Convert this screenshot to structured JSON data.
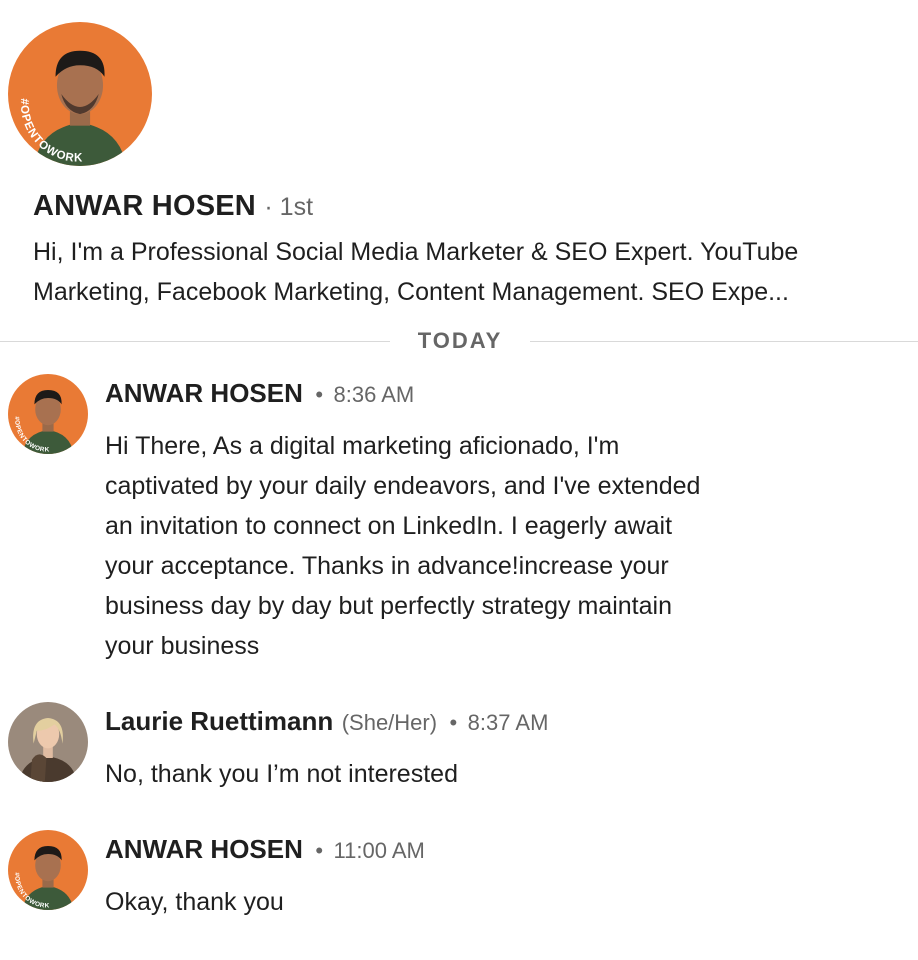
{
  "profile": {
    "name": "ANWAR HOSEN",
    "degree": "· 1st",
    "headline_lines": [
      "Hi, I'm a Professional Social Media Marketer & SEO Expert. YouTube",
      "Marketing, Facebook Marketing, Content Management. SEO Expe..."
    ],
    "badge_text": "#OPENTOWORK"
  },
  "divider": {
    "label": "TODAY"
  },
  "messages": [
    {
      "sender": "ANWAR HOSEN",
      "pronouns": "",
      "time": "8:36 AM",
      "lines": [
        "Hi There, As a digital marketing aficionado, I'm",
        "captivated by your daily endeavors, and I've extended",
        "an invitation to connect on LinkedIn. I eagerly await",
        "your acceptance. Thanks in advance!increase your",
        "business day by day but perfectly strategy maintain",
        "your business"
      ]
    },
    {
      "sender": "Laurie Ruettimann",
      "pronouns": "(She/Her)",
      "time": "8:37 AM",
      "lines": [
        "No, thank you I’m not interested"
      ]
    },
    {
      "sender": "ANWAR HOSEN",
      "pronouns": "",
      "time": "11:00 AM",
      "lines": [
        "Okay, thank you"
      ]
    }
  ],
  "colors": {
    "opentowork_ring": "#3b7a3e",
    "avatar_orange": "#e97a35",
    "divider_line": "#d9d9d9",
    "muted_text": "#666666"
  }
}
